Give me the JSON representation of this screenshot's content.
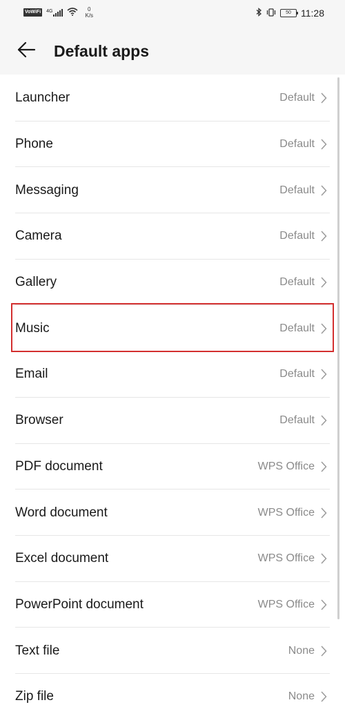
{
  "status_bar": {
    "vowifi": "VoWiFi",
    "network": "4G",
    "speed_value": "0",
    "speed_unit": "K/s",
    "battery": "50",
    "time": "11:28"
  },
  "app_bar": {
    "back_icon": "arrow-left-icon",
    "title": "Default apps"
  },
  "items": [
    {
      "label": "Launcher",
      "value": "Default"
    },
    {
      "label": "Phone",
      "value": "Default"
    },
    {
      "label": "Messaging",
      "value": "Default"
    },
    {
      "label": "Camera",
      "value": "Default"
    },
    {
      "label": "Gallery",
      "value": "Default"
    },
    {
      "label": "Music",
      "value": "Default"
    },
    {
      "label": "Email",
      "value": "Default"
    },
    {
      "label": "Browser",
      "value": "Default"
    },
    {
      "label": "PDF document",
      "value": "WPS Office"
    },
    {
      "label": "Word document",
      "value": "WPS Office"
    },
    {
      "label": "Excel document",
      "value": "WPS Office"
    },
    {
      "label": "PowerPoint document",
      "value": "WPS Office"
    },
    {
      "label": "Text file",
      "value": "None"
    },
    {
      "label": "Zip file",
      "value": "None"
    }
  ],
  "colors": {
    "highlight": "#d32f2f",
    "secondary_text": "#8a8a8a",
    "header_bg": "#f6f6f6"
  }
}
